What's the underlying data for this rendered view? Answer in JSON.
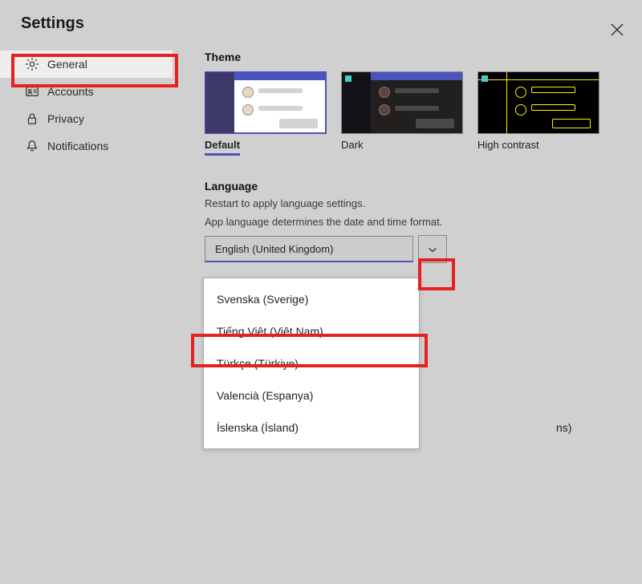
{
  "header": {
    "title": "Settings"
  },
  "sidebar": {
    "items": [
      {
        "label": "General",
        "icon": "gear-icon",
        "selected": true
      },
      {
        "label": "Accounts",
        "icon": "id-card-icon",
        "selected": false
      },
      {
        "label": "Privacy",
        "icon": "lock-icon",
        "selected": false
      },
      {
        "label": "Notifications",
        "icon": "bell-icon",
        "selected": false
      }
    ]
  },
  "theme": {
    "title": "Theme",
    "options": [
      {
        "label": "Default",
        "selected": true
      },
      {
        "label": "Dark",
        "selected": false
      },
      {
        "label": "High contrast",
        "selected": false
      }
    ]
  },
  "language": {
    "title": "Language",
    "restart_hint": "Restart to apply language settings.",
    "description": "App language determines the date and time format.",
    "selected": "English (United Kingdom)",
    "options": [
      "Svenska (Sverige)",
      "Tiếng Việt (Việt Nam)",
      "Türkçe (Türkiye)",
      "Valencià (Espanya)",
      "Íslenska (Ísland)"
    ],
    "highlighted_index": 1
  },
  "behind_fragment": "ns)"
}
